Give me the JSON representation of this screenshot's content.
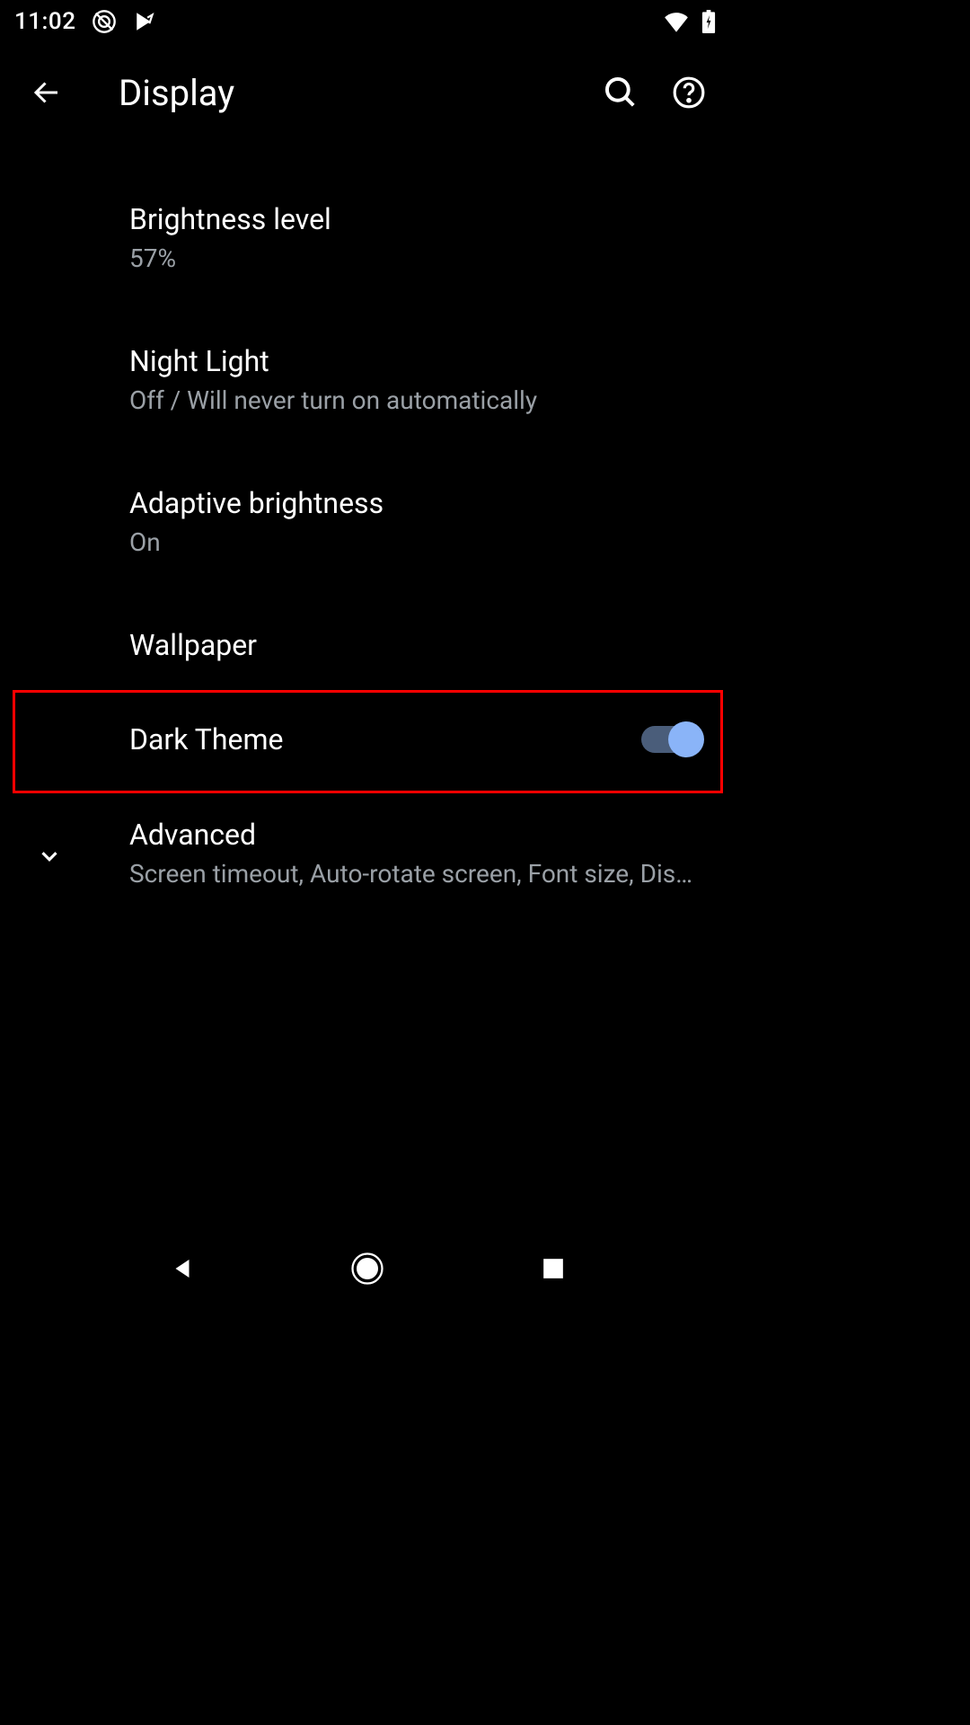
{
  "statusBar": {
    "time": "11:02"
  },
  "appBar": {
    "title": "Display"
  },
  "settings": {
    "brightness": {
      "title": "Brightness level",
      "value": "57%"
    },
    "nightLight": {
      "title": "Night Light",
      "subtitle": "Off / Will never turn on automatically"
    },
    "adaptiveBrightness": {
      "title": "Adaptive brightness",
      "subtitle": "On"
    },
    "wallpaper": {
      "title": "Wallpaper"
    },
    "darkTheme": {
      "title": "Dark Theme"
    },
    "advanced": {
      "title": "Advanced",
      "subtitle": "Screen timeout, Auto-rotate screen, Font size, Displ.."
    }
  }
}
